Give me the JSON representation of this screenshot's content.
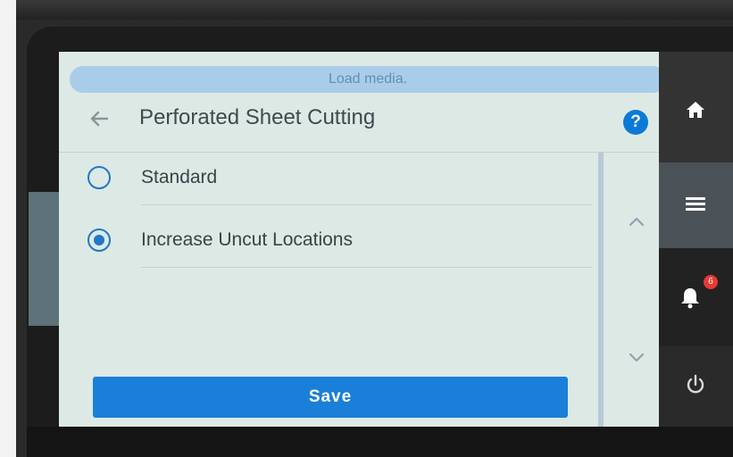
{
  "status": {
    "message": "Load media."
  },
  "header": {
    "title": "Perforated Sheet Cutting"
  },
  "options": [
    {
      "label": "Standard",
      "selected": false
    },
    {
      "label": "Increase Uncut Locations",
      "selected": true
    }
  ],
  "actions": {
    "save_label": "Save"
  },
  "side_nav": {
    "notification_count": "6"
  },
  "colors": {
    "accent": "#1a7fd8",
    "banner": "#a9cde8",
    "badge": "#e53935"
  }
}
